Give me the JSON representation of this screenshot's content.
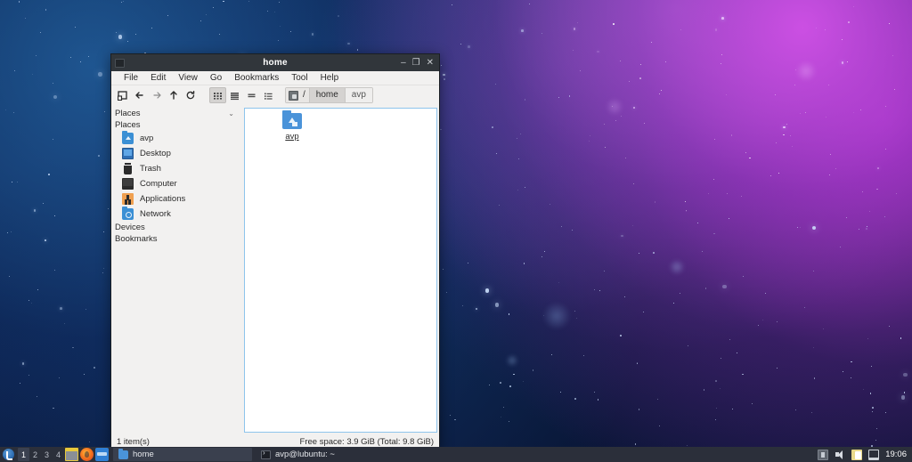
{
  "window": {
    "title": "home",
    "icon": "window-icon",
    "controls": {
      "minimize": "–",
      "maximize": "❐",
      "close": "✕"
    }
  },
  "menubar": {
    "items": [
      {
        "label": "File"
      },
      {
        "label": "Edit"
      },
      {
        "label": "View"
      },
      {
        "label": "Go"
      },
      {
        "label": "Bookmarks"
      },
      {
        "label": "Tool"
      },
      {
        "label": "Help"
      }
    ]
  },
  "toolbar": {
    "buttons": [
      {
        "name": "new-tab-icon",
        "glyph": "❐"
      },
      {
        "name": "back-icon",
        "glyph": "←"
      },
      {
        "name": "forward-icon",
        "glyph": "→"
      },
      {
        "name": "up-icon",
        "glyph": "↑"
      },
      {
        "name": "reload-icon",
        "glyph": "⟳"
      }
    ],
    "view_modes": [
      {
        "name": "icon-view",
        "active": true
      },
      {
        "name": "thumbnail-view",
        "active": false
      },
      {
        "name": "compact-view",
        "active": false
      },
      {
        "name": "detailed-list-view",
        "active": false
      }
    ]
  },
  "pathbar": {
    "root_icon": "drive-icon",
    "separator": "/",
    "crumbs": [
      {
        "label": "home",
        "current": false
      },
      {
        "label": "avp",
        "current": true
      }
    ]
  },
  "sidebar": {
    "header": "Places",
    "section_title": "Places",
    "items": [
      {
        "label": "avp",
        "icon": "home-folder-icon"
      },
      {
        "label": "Desktop",
        "icon": "desktop-icon"
      },
      {
        "label": "Trash",
        "icon": "trash-icon"
      },
      {
        "label": "Computer",
        "icon": "computer-icon"
      },
      {
        "label": "Applications",
        "icon": "applications-icon"
      },
      {
        "label": "Network",
        "icon": "network-icon"
      }
    ],
    "footer_sections": [
      {
        "label": "Devices"
      },
      {
        "label": "Bookmarks"
      }
    ]
  },
  "filepane": {
    "items": [
      {
        "label": "avp",
        "icon": "home-folder-icon"
      }
    ]
  },
  "statusbar": {
    "left": "1 item(s)",
    "right": "Free space: 3.9 GiB (Total: 9.8 GiB)"
  },
  "taskbar": {
    "logo": "lubuntu-logo",
    "desktops": [
      {
        "label": "1",
        "active": true
      },
      {
        "label": "2",
        "active": false
      },
      {
        "label": "3",
        "active": false
      },
      {
        "label": "4",
        "active": false
      }
    ],
    "launchers": [
      {
        "name": "file-manager-launcher-icon"
      },
      {
        "name": "firefox-launcher-icon"
      },
      {
        "name": "app-launcher-icon"
      }
    ],
    "windows": [
      {
        "label": "home",
        "icon": "folder-icon",
        "active": true
      },
      {
        "label": "avp@lubuntu: ~",
        "icon": "terminal-icon",
        "active": false
      }
    ],
    "tray": [
      {
        "name": "archive-tray-icon"
      },
      {
        "name": "volume-tray-icon"
      },
      {
        "name": "clipboard-tray-icon"
      },
      {
        "name": "display-tray-icon"
      }
    ],
    "clock": "19:06"
  },
  "colors": {
    "titlebar": "#31363b",
    "window_bg": "#f2f1f0",
    "pane_border": "#8ec4ec",
    "taskbar": "#2b2f3a",
    "folder_blue": "#4a93d9"
  }
}
